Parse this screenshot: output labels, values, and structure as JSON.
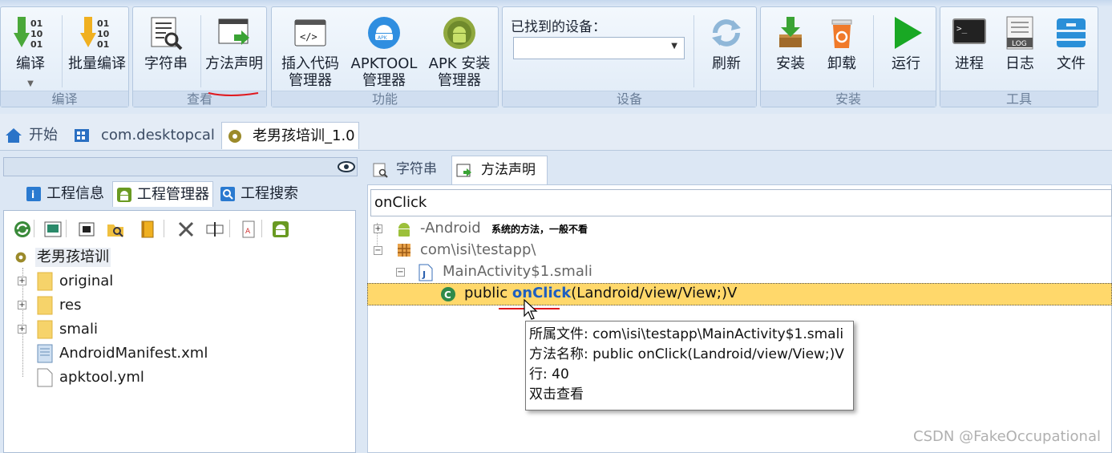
{
  "ribbon": {
    "groups": [
      {
        "caption": "编译",
        "buttons": [
          "编译",
          "批量编译"
        ]
      },
      {
        "caption": "查看",
        "buttons": [
          "字符串",
          "方法声明"
        ]
      },
      {
        "caption": "功能",
        "buttons": [
          "插入代码管理器",
          "APKTOOL管理器",
          "APK 安装管理器"
        ]
      },
      {
        "caption": "设备",
        "device_label": "已找到的设备：",
        "device_value": "",
        "buttons": [
          "刷新"
        ]
      },
      {
        "caption": "安装",
        "buttons": [
          "安装",
          "卸载",
          "运行"
        ]
      },
      {
        "caption": "工具",
        "buttons": [
          "进程",
          "日志",
          "文件"
        ]
      }
    ]
  },
  "doc_tabs": [
    "开始",
    "com.desktopcal",
    "老男孩培训_1.0"
  ],
  "left": {
    "search_value": "",
    "sub_tabs": [
      "工程信息",
      "工程管理器",
      "工程搜索"
    ],
    "tree_root": "老男孩培训",
    "tree_items": [
      "original",
      "res",
      "smali",
      "AndroidManifest.xml",
      "apktool.yml"
    ]
  },
  "right": {
    "tabs": [
      "字符串",
      "方法声明"
    ],
    "search_value": "onClick",
    "results": {
      "android_node": "-Android",
      "android_note": "系统的方法，一般不看",
      "package_node": "com\\isi\\testapp\\",
      "file_node": "MainActivity$1.smali",
      "method_prefix": "public ",
      "method_name": "onClick",
      "method_suffix": "(Landroid/view/View;)V"
    },
    "tooltip": {
      "line1": "所属文件: com\\isi\\testapp\\MainActivity$1.smali",
      "line2": "方法名称: public onClick(Landroid/view/View;)V",
      "line3": "行: 40",
      "line4": "双击查看"
    }
  },
  "watermark": "CSDN @FakeOccupational",
  "colors": {
    "accent": "#1f5fbf",
    "selection": "#ffd86b",
    "annotation": "#e0181e"
  }
}
